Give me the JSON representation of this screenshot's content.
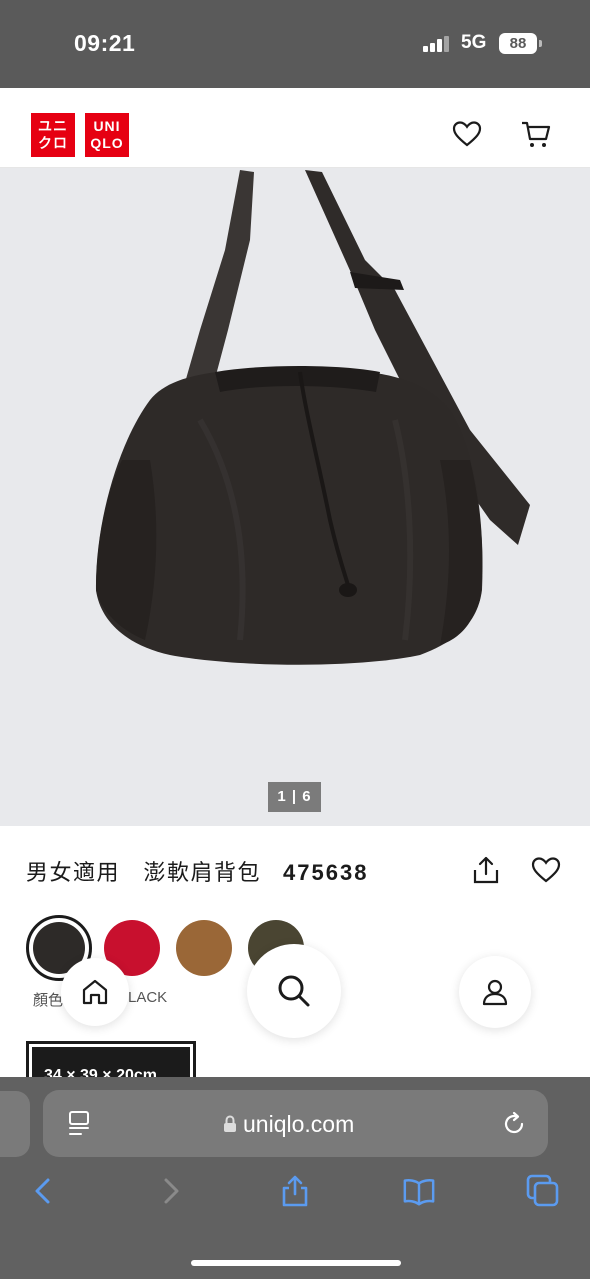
{
  "status_bar": {
    "time": "09:21",
    "network": "5G",
    "battery": "88"
  },
  "header": {
    "logo_lines": [
      "ユニ",
      "クロ"
    ],
    "logo_en_lines": [
      "UNI",
      "QLO"
    ]
  },
  "gallery": {
    "counter": "1 | 6"
  },
  "product": {
    "name": "男女適用　澎軟肩背包",
    "code": "475638",
    "colors": [
      {
        "name": "BLACK",
        "hex": "#2d2a28",
        "selected": true
      },
      {
        "name": "RED",
        "hex": "#c8102e"
      },
      {
        "name": "BROWN",
        "hex": "#9a6737"
      },
      {
        "name": "OLIVE",
        "hex": "#4a4532"
      }
    ],
    "color_label_prefix": "顏色",
    "color_label_value": "BLACK",
    "size_label": "34 × 39 × 20cm"
  },
  "browser": {
    "url": "uniqlo.com"
  },
  "colors": {
    "brand_red": "#e60012",
    "chrome_gray": "#616161",
    "safari_blue": "#5b9bf0"
  }
}
